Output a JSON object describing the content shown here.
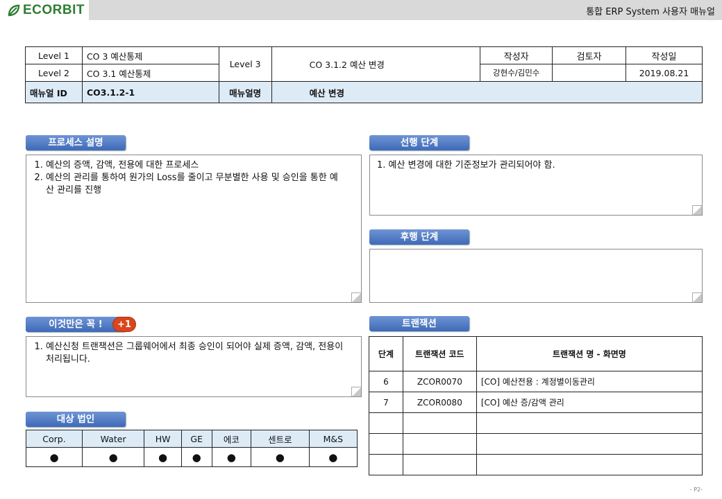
{
  "header": {
    "logo_text": "ECORBIT",
    "doc_title": "통합 ERP System 사용자 매뉴얼"
  },
  "info": {
    "level1_label": "Level 1",
    "level1_value": "CO 3 예산통제",
    "level2_label": "Level 2",
    "level2_value": "CO 3.1 예산통제",
    "level3_label": "Level 3",
    "level3_value": "CO 3.1.2 예산 변경",
    "writer_label": "작성자",
    "reviewer_label": "검토자",
    "date_label": "작성일",
    "writer_value": "강현수/김민수",
    "reviewer_value": "",
    "date_value": "2019.08.21",
    "manual_id_label": "매뉴얼 ID",
    "manual_id_value": "CO3.1.2-1",
    "manual_desc_label": "매뉴얼명",
    "manual_desc_value": "예산 변경"
  },
  "process": {
    "title": "프로세스 설명",
    "items": [
      "예산의 증액, 감액, 전용에 대한 프로세스",
      "예산의 관리를 통하여 원가의 Loss를 줄이고 무분별한 사용 및 승인을 통한 예산 관리를 진행"
    ]
  },
  "prior": {
    "title": "선행 단계",
    "text": "1. 예산 변경에 대한 기준정보가 관리되어야 함."
  },
  "after": {
    "title": "후행 단계",
    "text": ""
  },
  "must": {
    "title": "이것만은 꼭 !",
    "badge": "+1",
    "items": [
      "예산신청 트랜잭션은 그룹웨어에서 최종 승인이 되어야 실제 증액, 감액, 전용이 처리됩니다."
    ]
  },
  "corp": {
    "title": "대상 법인",
    "columns": [
      "Corp.",
      "Water",
      "HW",
      "GE",
      "에코",
      "센트로",
      "M&S"
    ],
    "marks": [
      "●",
      "●",
      "●",
      "●",
      "●",
      "●",
      "●"
    ]
  },
  "transaction": {
    "title": "트랜잭션",
    "headers": [
      "단계",
      "트랜잭션 코드",
      "트랜잭션 명 - 화면명"
    ],
    "rows": [
      [
        "6",
        "ZCOR0070",
        "[CO] 예산전용 : 계정별이동관리"
      ],
      [
        "7",
        "ZCOR0080",
        "[CO] 예산 증/감액 관리"
      ],
      [
        "",
        "",
        ""
      ],
      [
        "",
        "",
        ""
      ],
      [
        "",
        "",
        ""
      ]
    ]
  },
  "footer": {
    "page": "- P2-"
  },
  "colors": {
    "section_blue": "#3f6ab8",
    "header_fill": "#ddebf7",
    "logo_green": "#2e7d32",
    "badge_red": "#d9461c"
  }
}
